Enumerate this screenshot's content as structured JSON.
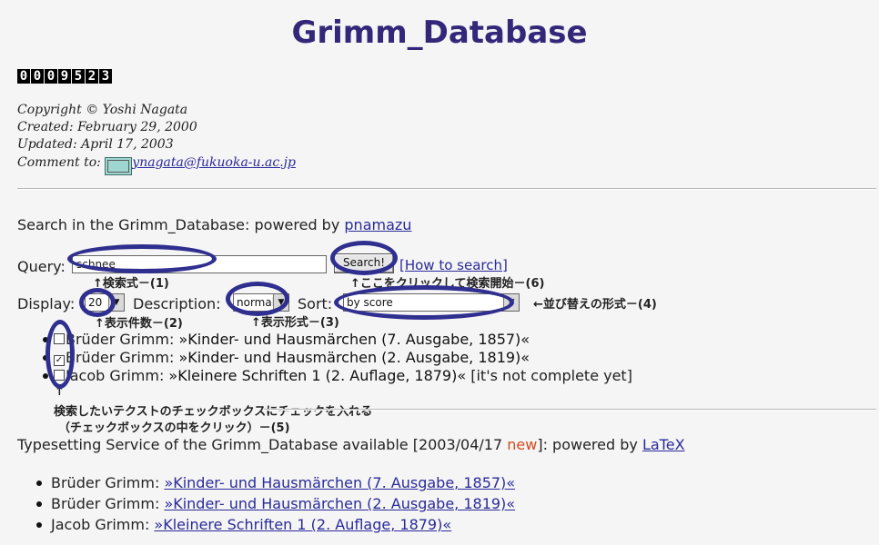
{
  "title": "Grimm_Database",
  "counter": [
    "0",
    "0",
    "0",
    "9",
    "5",
    "2",
    "3"
  ],
  "meta": {
    "copyright": "Copyright © Yoshi Nagata",
    "created": "Created: February 29, 2000",
    "updated": "Updated: April 17, 2003",
    "comment_label": "Comment to:",
    "email": "ynagata@fukuoka-u.ac.jp"
  },
  "search": {
    "heading_prefix": "Search in the Grimm_Database",
    "heading_suffix": ": powered by ",
    "heading_link": "pnamazu",
    "query_label": "Query:",
    "query_value": "schnee",
    "search_button": "Search!",
    "howto_link": "[How to search]",
    "display_label": "Display:",
    "display_value": "20",
    "description_label": "Description:",
    "description_value": "normal",
    "sort_label": "Sort:",
    "sort_value": "by score"
  },
  "annotations": {
    "a1": "↑検索式－(1)",
    "a6": "↑ここをクリックして検索開始－(6)",
    "a4": "←並び替えの形式－(4)",
    "a2": "↑表示件数－(2)",
    "a3": "↑表示形式－(3)",
    "arrow_up": "↑",
    "a5_line1": "検索したいテクストのチェックボックスにチェックを入れる",
    "a5_line2": "（チェックボックスの中をクリック）－(5)"
  },
  "texts": [
    {
      "checked": false,
      "author": "Brüder Grimm: ",
      "book": "»Kinder- und Hausmärchen (7. Ausgabe, 1857)«",
      "note": ""
    },
    {
      "checked": true,
      "author": "Brüder Grimm: ",
      "book": "»Kinder- und Hausmärchen (2. Ausgabe, 1819)«",
      "note": ""
    },
    {
      "checked": false,
      "author": "Jacob Grimm: ",
      "book": "»Kleinere Schriften 1 (2. Auflage, 1879)«",
      "note": " [it's not complete yet]"
    }
  ],
  "typesetting": {
    "prefix": "Typesetting Service of the Grimm_Database available [2003/04/17 ",
    "new": "new",
    "suffix": "]: powered by ",
    "link": "LaTeX"
  },
  "latex_items": [
    {
      "author": "Brüder Grimm: ",
      "link": "»Kinder- und Hausmärchen (7. Ausgabe, 1857)«"
    },
    {
      "author": "Brüder Grimm: ",
      "link": "»Kinder- und Hausmärchen (2. Ausgabe, 1819)«"
    },
    {
      "author": "Jacob Grimm: ",
      "link": "»Kleinere Schriften 1 (2. Auflage, 1879)«"
    }
  ],
  "colors": {
    "title": "#33277a",
    "link": "#2a2a9a",
    "new": "#d34b1d",
    "annotation_oval": "#2f2f8f"
  }
}
